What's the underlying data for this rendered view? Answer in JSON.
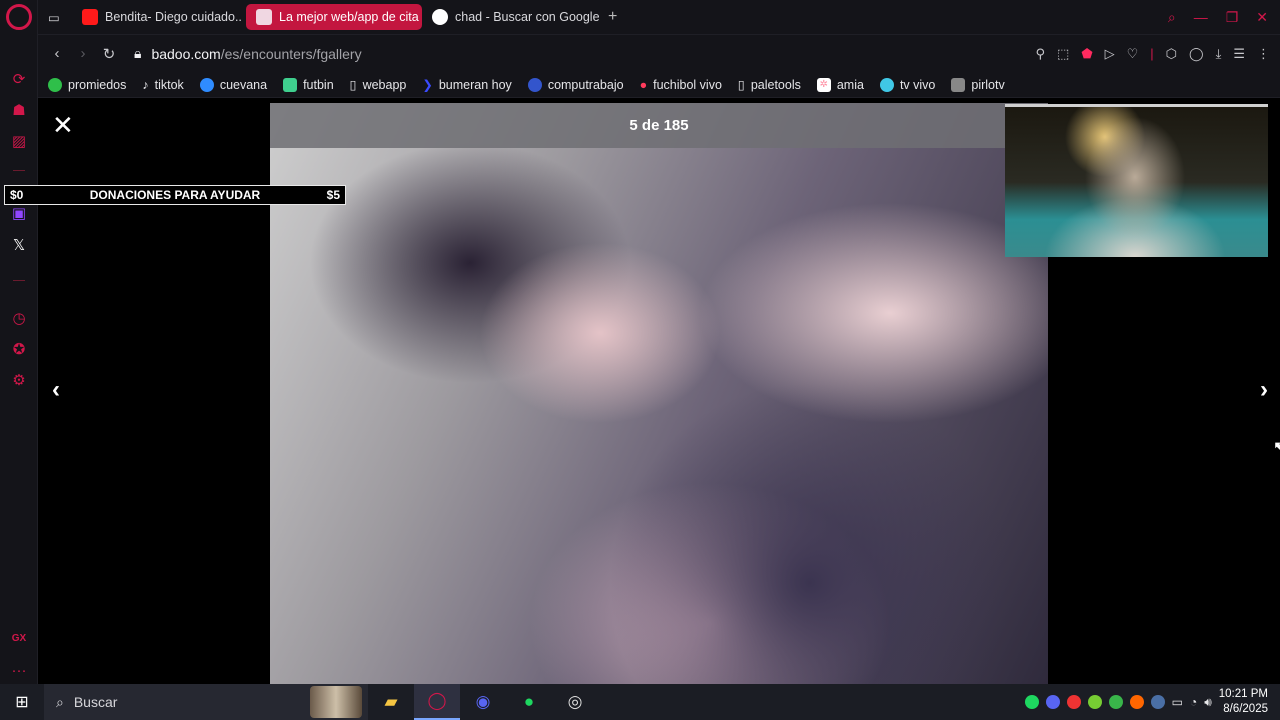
{
  "browser": {
    "tabs": [
      {
        "label": "Bendita- Diego cuidado..",
        "favicon_color": "#ff1a1a",
        "active": false
      },
      {
        "label": "La mejor web/app de cita",
        "favicon_color": "#f0d7e2",
        "active": true
      },
      {
        "label": "chad - Buscar con Google",
        "favicon_color": "#ffffff",
        "active": false
      }
    ],
    "new_tab": "+",
    "url_domain": "badoo.com",
    "url_path": "/es/encounters/fgallery",
    "bookmarks": [
      {
        "label": "promiedos",
        "color": "#2fbf4a"
      },
      {
        "label": "tiktok",
        "color": "#ffffff"
      },
      {
        "label": "cuevana",
        "color": "#2f8cff"
      },
      {
        "label": "futbin",
        "color": "#3fcf8e"
      },
      {
        "label": "webapp",
        "color": "#dddddd"
      },
      {
        "label": "bumeran hoy",
        "color": "#3a4bff"
      },
      {
        "label": "computrabajo",
        "color": "#3355cc"
      },
      {
        "label": "fuchibol vivo",
        "color": "#ff3b5c"
      },
      {
        "label": "paletools",
        "color": "#dddddd"
      },
      {
        "label": "amia",
        "color": "#ff8fa3"
      },
      {
        "label": "tv vivo",
        "color": "#40c8e6"
      },
      {
        "label": "pirlotv",
        "color": "#cccccc"
      }
    ],
    "accent": "#d2174a"
  },
  "gallery": {
    "counter": "5 de 185",
    "close_label": "✕",
    "prev_label": "‹",
    "next_label": "›"
  },
  "donation_bar": {
    "left_amount": "$0",
    "title": "DONACIONES PARA AYUDAR",
    "right_amount": "$5",
    "progress_fraction": 0
  },
  "taskbar": {
    "search_placeholder": "Buscar",
    "time": "10:21 PM",
    "date": "8/6/2025"
  }
}
